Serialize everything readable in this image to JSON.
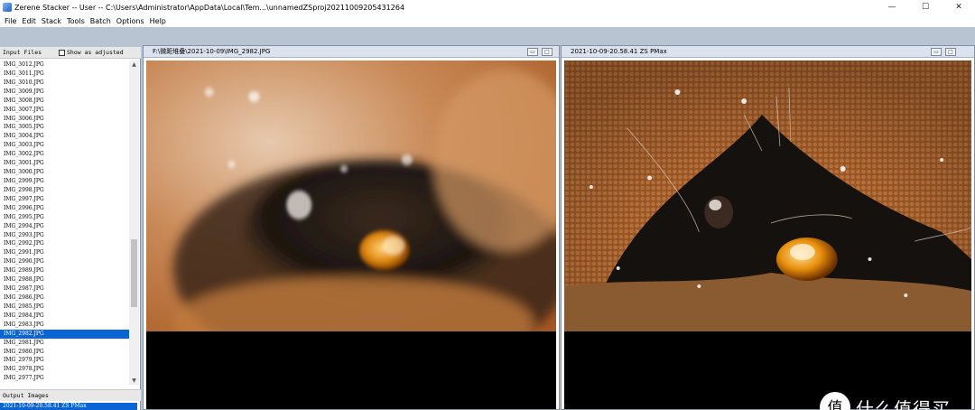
{
  "window": {
    "title": "Zerene Stacker -- User -- C:\\Users\\Administrator\\AppData\\Local\\Tem...\\unnamedZSproj20211009205431264",
    "minimize": "—",
    "maximize": "☐",
    "close": "✕"
  },
  "menu": [
    "File",
    "Edit",
    "Stack",
    "Tools",
    "Batch",
    "Options",
    "Help"
  ],
  "input_files": {
    "label": "Input Files",
    "show_adjusted_label": "Show as adjusted",
    "show_adjusted_checked": false,
    "files": [
      "IMG_3012.JPG",
      "IMG_3011.JPG",
      "IMG_3010.JPG",
      "IMG_3009.JPG",
      "IMG_3008.JPG",
      "IMG_3007.JPG",
      "IMG_3006.JPG",
      "IMG_3005.JPG",
      "IMG_3004.JPG",
      "IMG_3003.JPG",
      "IMG_3002.JPG",
      "IMG_3001.JPG",
      "IMG_3000.JPG",
      "IMG_2999.JPG",
      "IMG_2998.JPG",
      "IMG_2997.JPG",
      "IMG_2996.JPG",
      "IMG_2995.JPG",
      "IMG_2994.JPG",
      "IMG_2993.JPG",
      "IMG_2992.JPG",
      "IMG_2991.JPG",
      "IMG_2990.JPG",
      "IMG_2989.JPG",
      "IMG_2988.JPG",
      "IMG_2987.JPG",
      "IMG_2986.JPG",
      "IMG_2985.JPG",
      "IMG_2984.JPG",
      "IMG_2983.JPG",
      "IMG_2982.JPG",
      "IMG_2981.JPG",
      "IMG_2980.JPG",
      "IMG_2979.JPG",
      "IMG_2978.JPG",
      "IMG_2977.JPG"
    ],
    "selected": "IMG_2982.JPG"
  },
  "output_images": {
    "label": "Output Images",
    "items": [
      "2021-10-09-20.58.41 ZS PMax"
    ]
  },
  "panes": {
    "left": {
      "title": "F:\\微距堆叠\\2021-10-09\\IMG_2982.JPG",
      "btn_min": "▭",
      "btn_max": "□"
    },
    "right": {
      "title": "2021-10-09-20.58.41 ZS PMax",
      "btn_min": "▭",
      "btn_max": "□"
    }
  },
  "watermark": {
    "text": "什么值得买",
    "logo": "值"
  },
  "colors": {
    "selection": "#0a64d6",
    "workspace": "#b9c4d3",
    "pane_header": "#dde3ee"
  }
}
